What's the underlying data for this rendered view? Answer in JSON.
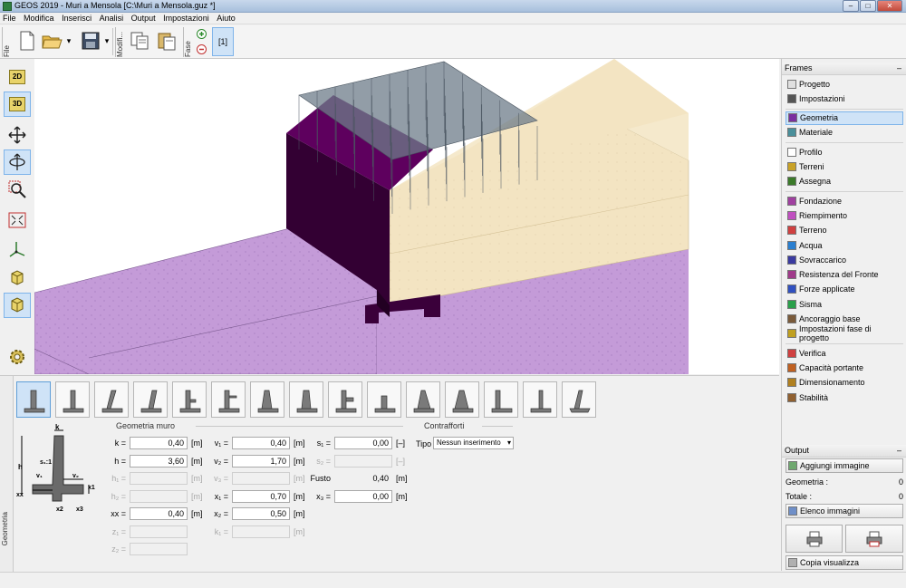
{
  "window": {
    "title": "GEOS 2019 - Muri a Mensola  [C:\\Muri a Mensola.guz *]"
  },
  "menu": [
    "File",
    "Modifica",
    "Inserisci",
    "Analisi",
    "Output",
    "Impostazioni",
    "Aiuto"
  ],
  "toolbar": {
    "file_label": "File",
    "modifica_label": "Modifi...",
    "fase_label": "Fase",
    "stage_button": "[1]"
  },
  "left_tools": {
    "view2d": "2D",
    "view3d": "3D"
  },
  "bottom": {
    "tab_label": "Geometria",
    "group_wall": "Geometria muro",
    "group_counterforts": "Contrafforti",
    "diagram_labels": {
      "k": "k",
      "h": "h",
      "s1": "s₁:1",
      "v1": "v₁",
      "v2": "v₂",
      "xx": "xx",
      "x1": "x1",
      "x2": "x2",
      "x3": "x3"
    },
    "fields": {
      "k": {
        "label": "k =",
        "value": "0,40",
        "unit": "[m]"
      },
      "h": {
        "label": "h =",
        "value": "3,60",
        "unit": "[m]"
      },
      "h1": {
        "label": "h₁ =",
        "value": "",
        "unit": "[m]"
      },
      "h2": {
        "label": "h₂ =",
        "value": "",
        "unit": "[m]"
      },
      "xx": {
        "label": "xx =",
        "value": "0,40",
        "unit": "[m]"
      },
      "z1": {
        "label": "z₁ =",
        "value": "",
        "unit": ""
      },
      "z2": {
        "label": "z₂ =",
        "value": "",
        "unit": ""
      },
      "v1": {
        "label": "v₁ =",
        "value": "0,40",
        "unit": "[m]"
      },
      "v2": {
        "label": "v₂ =",
        "value": "1,70",
        "unit": "[m]"
      },
      "v3": {
        "label": "v₃ =",
        "value": "",
        "unit": "[m]"
      },
      "x1": {
        "label": "x₁ =",
        "value": "0,70",
        "unit": "[m]"
      },
      "x2": {
        "label": "x₂ =",
        "value": "0,50",
        "unit": "[m]"
      },
      "k1": {
        "label": "k₁ =",
        "value": "",
        "unit": "[m]"
      },
      "s1": {
        "label": "s₁ =",
        "value": "0,00",
        "unit": "[–]"
      },
      "s2": {
        "label": "s₂ =",
        "value": "",
        "unit": "[–]"
      },
      "fusto": {
        "label": "Fusto",
        "value": "0,40",
        "unit": "[m]"
      },
      "x3": {
        "label": "x₃ =",
        "value": "0,00",
        "unit": "[m]"
      }
    },
    "tipo": {
      "label": "Tipo",
      "value": "Nessun inserimento"
    }
  },
  "frames": {
    "title": "Frames",
    "items": [
      {
        "label": "Progetto",
        "icon": "document-icon",
        "color": "#e0e0e0"
      },
      {
        "label": "Impostazioni",
        "icon": "gear-icon",
        "color": "#555555"
      },
      {
        "label": "Geometria",
        "icon": "wall-geometry-icon",
        "color": "#7a2fa0"
      },
      {
        "label": "Materiale",
        "icon": "material-icon",
        "color": "#4a8f9a"
      },
      {
        "label": "Profilo",
        "icon": "profile-icon",
        "color": "#ffffff"
      },
      {
        "label": "Terreni",
        "icon": "soil-icon",
        "color": "#c9a227"
      },
      {
        "label": "Assegna",
        "icon": "assign-icon",
        "color": "#3b7a2a"
      },
      {
        "label": "Fondazione",
        "icon": "foundation-icon",
        "color": "#a040a0"
      },
      {
        "label": "Riempimento",
        "icon": "backfill-icon",
        "color": "#c050c0"
      },
      {
        "label": "Terreno",
        "icon": "terrain-icon",
        "color": "#d04040"
      },
      {
        "label": "Acqua",
        "icon": "water-icon",
        "color": "#2a7fd0"
      },
      {
        "label": "Sovraccarico",
        "icon": "surcharge-icon",
        "color": "#3a3aa0"
      },
      {
        "label": "Resistenza del Fronte",
        "icon": "front-resistance-icon",
        "color": "#a03a8a"
      },
      {
        "label": "Forze applicate",
        "icon": "applied-forces-icon",
        "color": "#3050c0"
      },
      {
        "label": "Sisma",
        "icon": "earthquake-icon",
        "color": "#2aa04a"
      },
      {
        "label": "Ancoraggio base",
        "icon": "anchor-icon",
        "color": "#7a5a3a"
      },
      {
        "label": "Impostazioni fase di progetto",
        "icon": "stage-settings-icon",
        "color": "#c0a020"
      },
      {
        "label": "Verifica",
        "icon": "verification-icon",
        "color": "#d04040"
      },
      {
        "label": "Capacità portante",
        "icon": "bearing-capacity-icon",
        "color": "#c06020"
      },
      {
        "label": "Dimensionamento",
        "icon": "dimensioning-icon",
        "color": "#b08020"
      },
      {
        "label": "Stabilità",
        "icon": "stability-icon",
        "color": "#906030"
      }
    ],
    "selected": "Geometria"
  },
  "output": {
    "title": "Output",
    "add_image": "Aggiungi immagine",
    "geometria_label": "Geometria :",
    "geometria_count": "0",
    "totale_label": "Totale :",
    "totale_count": "0",
    "image_list": "Elenco immagini",
    "copy_view": "Copia  visualizza"
  },
  "colors": {
    "wall": "#330033",
    "backfill": "#f3e4c2",
    "ground": "#c49bd8",
    "load": "#6d7c8a",
    "accent": "#cfe3f7"
  }
}
